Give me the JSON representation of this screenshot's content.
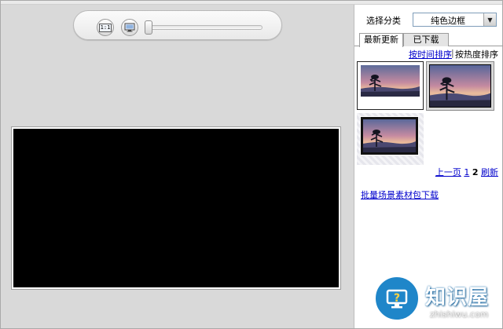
{
  "toolbar": {
    "actual_size_icon": "actual-size-icon",
    "actual_size_label": "1:1",
    "fit_screen_icon": "fit-screen-icon",
    "zoom_level": 0
  },
  "panel": {
    "category_label": "选择分类",
    "category_value": "纯色边框",
    "tabs": [
      {
        "label": "最新更新",
        "active": true
      },
      {
        "label": "已下载",
        "active": false
      }
    ],
    "sort_by_time": "按时间排序",
    "sort_separator": "|",
    "sort_by_heat": "按热度排序",
    "pagination": {
      "prev": "上一页",
      "pages": [
        "1",
        "2"
      ],
      "current": "2",
      "refresh": "刷新"
    },
    "bulk_download": "批量场景素材包下载"
  },
  "watermark": {
    "title": "知识屋",
    "subtitle": "zhishiwu.com"
  },
  "colors": {
    "workspace_bg": "#d9d9d9",
    "canvas_bg": "#000000",
    "link": "#0000cc",
    "accent": "#1f86c9"
  }
}
